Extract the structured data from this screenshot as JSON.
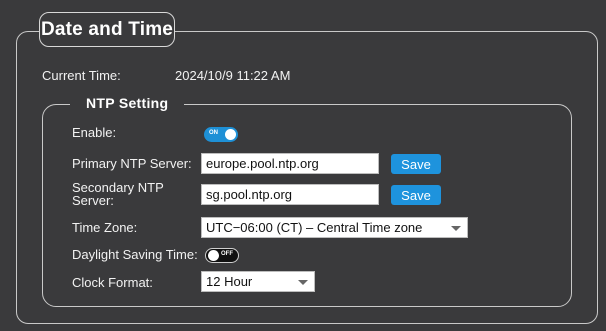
{
  "page": {
    "title": "Date and Time"
  },
  "current_time": {
    "label": "Current Time:",
    "value": "2024/10/9 11:22 AM"
  },
  "ntp": {
    "legend": "NTP Setting",
    "enable": {
      "label": "Enable:",
      "state": "ON",
      "toggle_text": "ON"
    },
    "primary_server": {
      "label": "Primary NTP Server:",
      "value": "europe.pool.ntp.org",
      "save_label": "Save"
    },
    "secondary_server": {
      "label_line1": "Secondary NTP",
      "label_line2": "Server:",
      "value": "sg.pool.ntp.org",
      "save_label": "Save"
    },
    "time_zone": {
      "label": "Time Zone:",
      "selected": "UTC−06:00 (CT) – Central Time zone"
    },
    "daylight_saving": {
      "label": "Daylight Saving Time:",
      "state": "OFF",
      "toggle_text": "OFF"
    },
    "clock_format": {
      "label": "Clock Format:",
      "selected": "12 Hour"
    }
  },
  "colors": {
    "background": "#3a3a3c",
    "accent_blue": "#1e93dd",
    "border": "#c9c9c9"
  }
}
